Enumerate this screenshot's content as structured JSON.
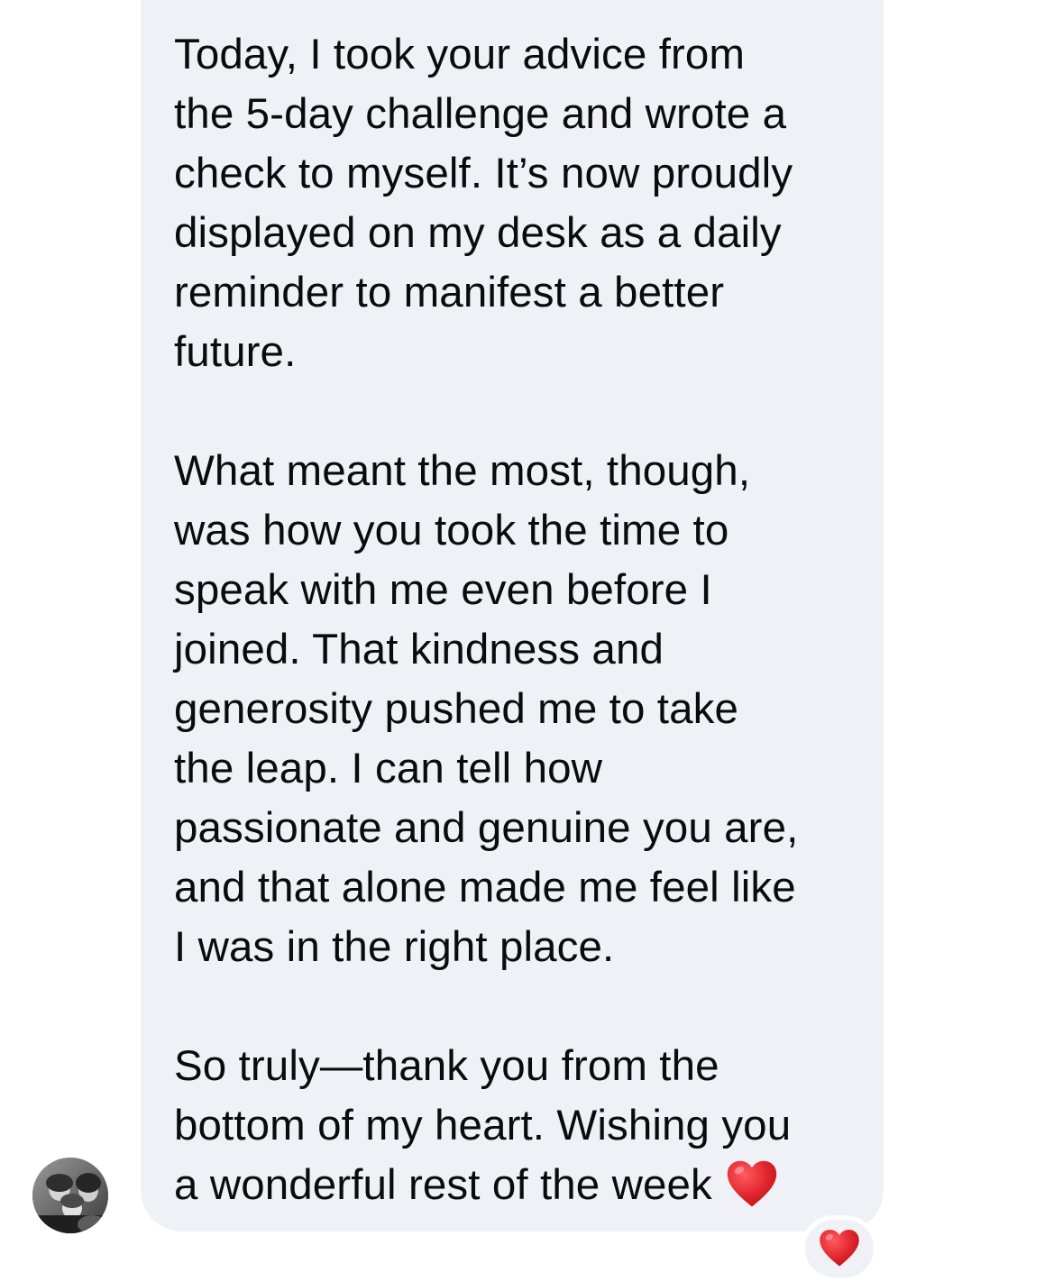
{
  "message": {
    "paragraphs": [
      "Today, I took your advice from\nthe 5-day challenge and wrote a\ncheck to myself. It’s now proudly\ndisplayed on my desk as a daily\nreminder to manifest a better\nfuture.",
      "What meant the most, though,\nwas how you took the time to\nspeak with me even before I\njoined. That kindness and\ngenerosity pushed me to take\nthe leap. I can tell how\npassionate and genuine you are,\nand that alone made me feel like\nI was in the right place.",
      "So truly—thank you from the\nbottom of my heart. Wishing you\na wonderful rest of the week"
    ],
    "trailing_emoji": "heart-emoji"
  },
  "reaction": {
    "icon": "heart-emoji"
  },
  "sender": {
    "avatar_icon": "avatar-photo"
  },
  "colors": {
    "bubble": "#f0f1f6",
    "text": "#0b0b0b",
    "heart": "#e0242b"
  }
}
